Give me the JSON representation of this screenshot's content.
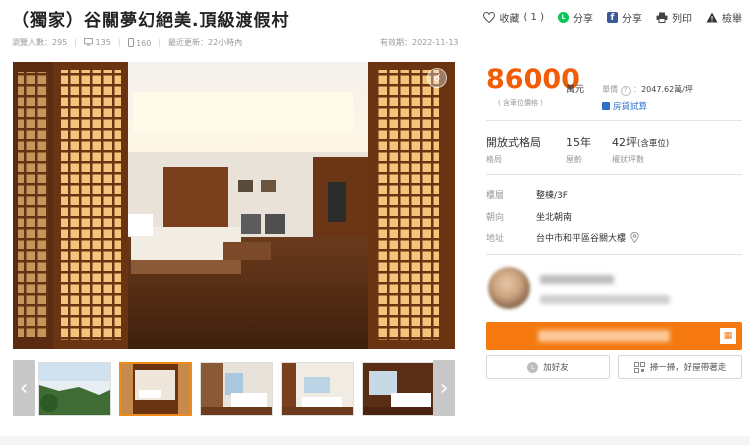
{
  "title": "（獨家）谷關夢幻絕美.頂級渡假村",
  "actions": {
    "favorite_label": "收藏",
    "favorite_count": "( 1 )",
    "line_share": "分享",
    "fb_share": "分享",
    "print": "列印",
    "report": "檢舉"
  },
  "meta": {
    "views_label": "瀏覽人數：",
    "views": "295",
    "desktop_count": "135",
    "mobile_count": "160",
    "updated_label": "最近更新：",
    "updated": "22小時內",
    "valid_label": "有效期：",
    "valid_date": "2022-11-13"
  },
  "price": {
    "amount": "86000",
    "unit": "萬元",
    "note": "( 含車位價格 )",
    "unit_price_label": "單價",
    "unit_price": "2047.62萬/坪",
    "loan_label": "房貸試算"
  },
  "specs": [
    {
      "value": "開放式格局",
      "extra": "",
      "label": "格局"
    },
    {
      "value": "15年",
      "extra": "",
      "label": "屋齡"
    },
    {
      "value": "42坪",
      "extra": "(含車位)",
      "label": "權狀坪數"
    }
  ],
  "details": {
    "floor_label": "樓層",
    "floor_value": "整棟/3F",
    "facing_label": "朝向",
    "facing_value": "坐北朝南",
    "address_label": "地址",
    "address_value": "台中市和平區谷關大樓"
  },
  "contact": {
    "add_friend": "加好友",
    "scan_label": "掃一掃，好屋帶著走"
  },
  "colors": {
    "accent": "#f25c05",
    "call_button": "#f5790f",
    "link": "#2a6fc9"
  }
}
